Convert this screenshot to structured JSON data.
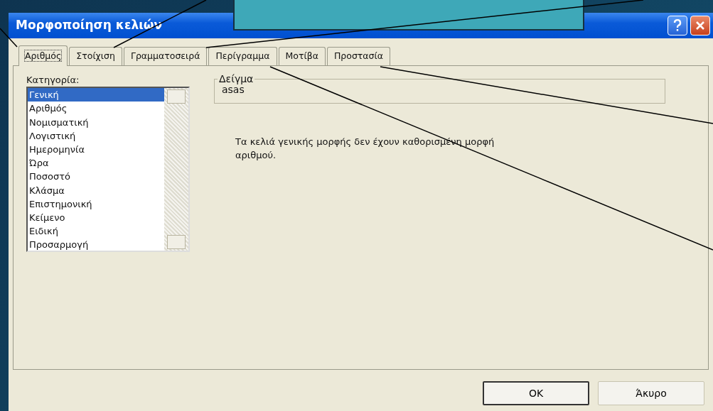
{
  "window": {
    "title": "Μορφοποίηση κελιών"
  },
  "tabs": [
    {
      "label": "Αριθμός",
      "selected": true
    },
    {
      "label": "Στοίχιση",
      "selected": false
    },
    {
      "label": "Γραμματοσειρά",
      "selected": false
    },
    {
      "label": "Περίγραμμα",
      "selected": false
    },
    {
      "label": "Μοτίβα",
      "selected": false
    },
    {
      "label": "Προστασία",
      "selected": false
    }
  ],
  "category": {
    "label": "Κατηγορία:",
    "items": [
      {
        "label": "Γενική",
        "selected": true
      },
      {
        "label": "Αριθμός",
        "selected": false
      },
      {
        "label": "Νομισματική",
        "selected": false
      },
      {
        "label": "Λογιστική",
        "selected": false
      },
      {
        "label": "Ημερομηνία",
        "selected": false
      },
      {
        "label": "Ώρα",
        "selected": false
      },
      {
        "label": "Ποσοστό",
        "selected": false
      },
      {
        "label": "Κλάσμα",
        "selected": false
      },
      {
        "label": "Επιστημονική",
        "selected": false
      },
      {
        "label": "Κείμενο",
        "selected": false
      },
      {
        "label": "Ειδική",
        "selected": false
      },
      {
        "label": "Προσαρμογή",
        "selected": false
      }
    ]
  },
  "sample": {
    "label": "Δείγμα",
    "value": "asas"
  },
  "description": "Τα κελιά γενικής μορφής δεν έχουν καθορισμένη μορφή αριθμού.",
  "buttons": [
    {
      "label": "OK",
      "default": true
    },
    {
      "label": "Άκυρο",
      "default": false
    }
  ]
}
